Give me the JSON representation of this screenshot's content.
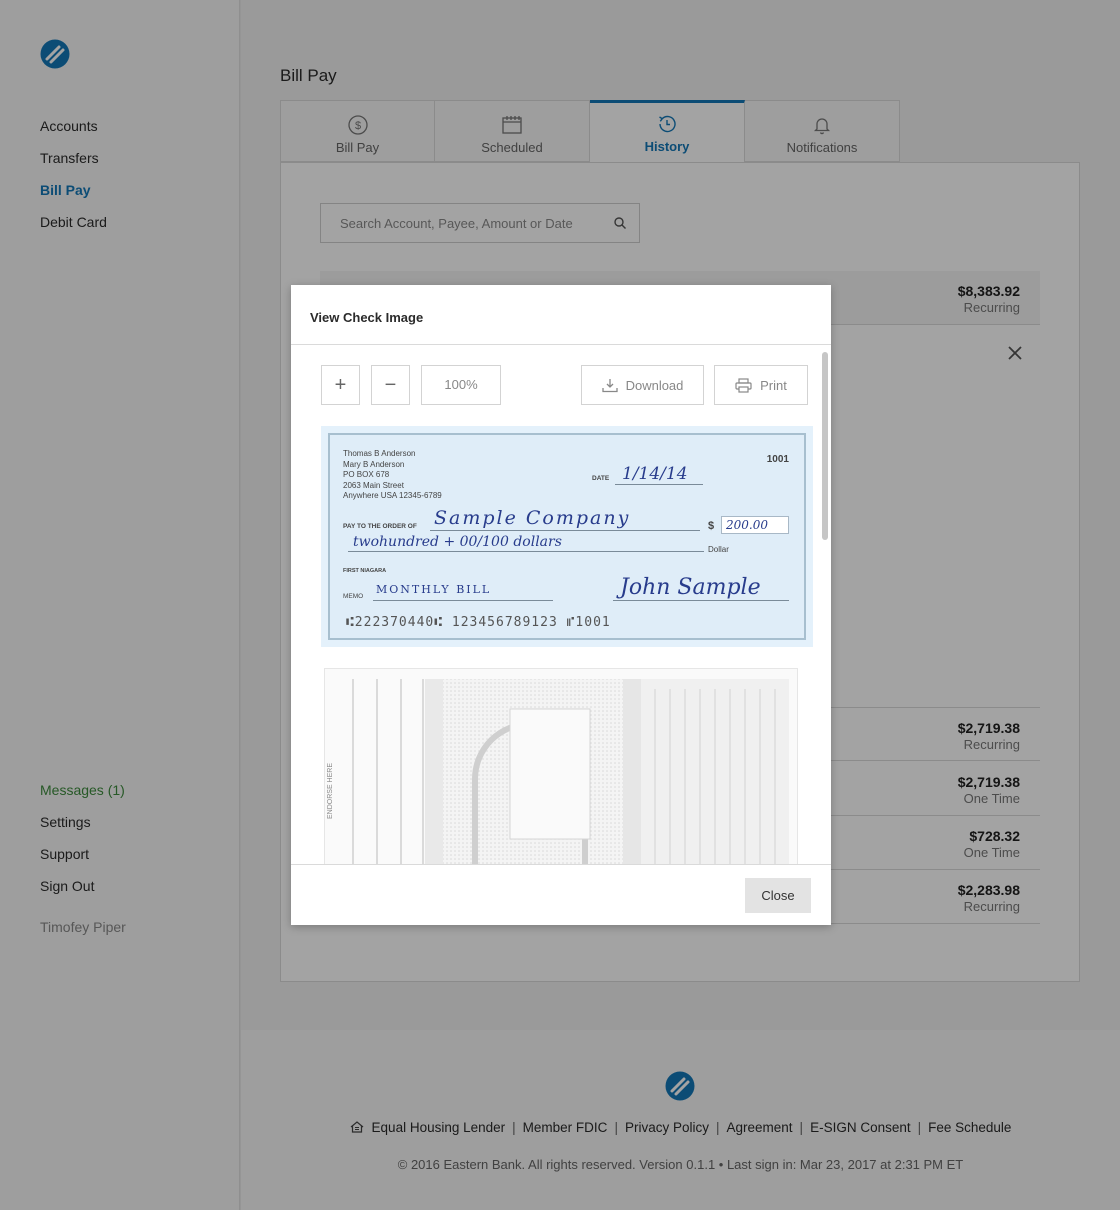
{
  "sidebar": {
    "nav": [
      "Accounts",
      "Transfers",
      "Bill Pay",
      "Debit Card"
    ],
    "secondary": [
      "Messages (1)",
      "Settings",
      "Support",
      "Sign Out"
    ],
    "user": "Timofey Piper"
  },
  "page": {
    "title": "Bill Pay"
  },
  "tabs": [
    {
      "label": "Bill Pay",
      "icon": "dollar-circle-icon"
    },
    {
      "label": "Scheduled",
      "icon": "calendar-icon"
    },
    {
      "label": "History",
      "icon": "history-icon",
      "active": true
    },
    {
      "label": "Notifications",
      "icon": "bell-icon"
    }
  ],
  "search": {
    "placeholder": "Search Account, Payee, Amount or Date"
  },
  "payments": [
    {
      "amount": "$8,383.92",
      "type": "Recurring"
    },
    {
      "amount": "$2,719.38",
      "type": "Recurring"
    },
    {
      "amount": "$2,719.38",
      "type": "One Time"
    },
    {
      "amount": "$728.32",
      "type": "One Time"
    },
    {
      "amount": "$2,283.98",
      "type": "Recurring"
    }
  ],
  "modal": {
    "title": "View Check Image",
    "zoom": "100%",
    "download": "Download",
    "print": "Print",
    "close": "Close",
    "check": {
      "address": [
        "Thomas B Anderson",
        "Mary B Anderson",
        "PO BOX 678",
        "2063 Main Street",
        "Anywhere USA 12345-6789"
      ],
      "number": "1001",
      "date_label": "DATE",
      "date": "1/14/14",
      "pay_label": "PAY TO THE ORDER OF",
      "payee": "Sample Company",
      "amount": "200.00",
      "words": "twohundred + 00/100 dollars",
      "dollar_label": "Dollar",
      "bank": "FIRST NIAGARA",
      "memo_label": "MEMO",
      "memo": "MONTHLY BILL",
      "signature": "John Sample",
      "micr": "⑆222370440⑆ 123456789123 ⑈1001"
    },
    "back": {
      "endorse": "ENDORSE HERE"
    }
  },
  "footer": {
    "links": [
      "Equal Housing Lender",
      "Member FDIC",
      "Privacy Policy",
      "Agreement",
      "E-SIGN Consent",
      "Fee Schedule"
    ],
    "copyright": "© 2016 Eastern Bank. All rights reserved. Version 0.1.1 • Last sign in: Mar 23, 2017 at 2:31 PM ET"
  },
  "colors": {
    "accent": "#1478b8",
    "messages": "#3d8b3d"
  }
}
